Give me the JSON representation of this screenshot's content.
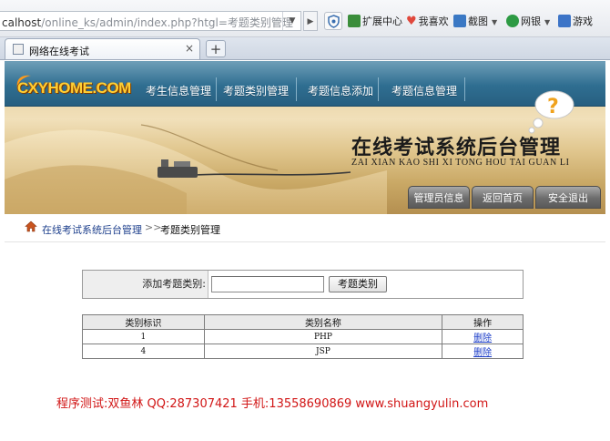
{
  "browser": {
    "address_prefix": "calhost",
    "address_rest": "/online_ks/admin/index.php?htgl=考题类别管理",
    "toolbar_items": [
      {
        "label": "扩展中心",
        "icon": "extension-icon",
        "color": "#3b8e3b"
      },
      {
        "label": "我喜欢",
        "icon": "heart-icon",
        "color": "#e0483c"
      },
      {
        "label": "截图",
        "icon": "screenshot-icon",
        "color": "#3a78c4"
      },
      {
        "label": "网银",
        "icon": "bank-icon",
        "color": "#2d9a43"
      },
      {
        "label": "游戏",
        "icon": "game-icon",
        "color": "#3c74c7"
      }
    ],
    "tab_title": "网络在线考试",
    "tab_close": "×",
    "new_tab": "+"
  },
  "header": {
    "logo": "CXYHOME.COM",
    "nav": [
      "考生信息管理",
      "考题类别管理",
      "考题信息添加",
      "考题信息管理"
    ],
    "system_title": "在线考试系统后台管理",
    "system_subtitle": "ZAI XIAN KAO SHI XI TONG HOU TAI GUAN LI",
    "buttons": [
      "管理员信息",
      "返回首页",
      "安全退出"
    ]
  },
  "breadcrumb": {
    "root": "在线考试系统后台管理",
    "separator": ">>",
    "current": "考题类别管理"
  },
  "add_form": {
    "label": "添加考题类别:",
    "input_value": "",
    "button_label": "考题类别"
  },
  "table": {
    "headers": [
      "类别标识",
      "类别名称",
      "操作"
    ],
    "rows": [
      {
        "id": "1",
        "name": "PHP",
        "action": "删除"
      },
      {
        "id": "4",
        "name": "JSP",
        "action": "删除"
      }
    ]
  },
  "footer": {
    "credit": "程序测试:双鱼林 QQ:287307421 手机:13558690869 www.shuangyulin.com"
  },
  "colors": {
    "nav_band": "#2f6e91",
    "link": "#1a3cc8",
    "footer_text": "#d11515"
  }
}
